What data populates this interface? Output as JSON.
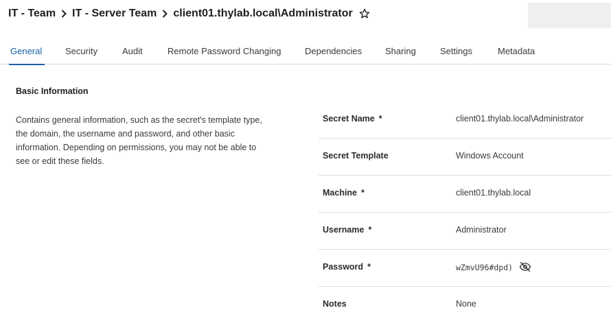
{
  "breadcrumb": {
    "items": [
      "IT - Team",
      "IT - Server Team"
    ],
    "current": "client01.thylab.local\\Administrator"
  },
  "tabs": [
    {
      "label": "General",
      "active": true
    },
    {
      "label": "Security",
      "active": false
    },
    {
      "label": "Audit",
      "active": false
    },
    {
      "label": "Remote Password Changing",
      "active": false
    },
    {
      "label": "Dependencies",
      "active": false
    },
    {
      "label": "Sharing",
      "active": false
    },
    {
      "label": "Settings",
      "active": false
    },
    {
      "label": "Metadata",
      "active": false
    }
  ],
  "section": {
    "title": "Basic Information",
    "description": "Contains general information, such as the secret's template type, the domain, the username and password, and other basic information. Depending on permissions, you may not be able to see or edit these fields."
  },
  "fields": [
    {
      "label": "Secret Name",
      "required_mark": "*",
      "value": "client01.thylab.local\\Administrator"
    },
    {
      "label": "Secret Template",
      "value": "Windows Account"
    },
    {
      "label": "Machine",
      "required_mark": "*",
      "value": "client01.thylab.local"
    },
    {
      "label": "Username",
      "required_mark": "*",
      "value": "Administrator"
    },
    {
      "label": "Password",
      "required_mark": "*",
      "value": "wZmvU96#dpd)"
    },
    {
      "label": "Notes",
      "value": "None"
    }
  ],
  "icons": {
    "breadcrumb_separator": "chevron-right-icon",
    "favorite": "star-outline-icon",
    "password_toggle": "eye-off-icon"
  },
  "colors": {
    "accent": "#1a5fa8",
    "divider": "#dedede"
  }
}
